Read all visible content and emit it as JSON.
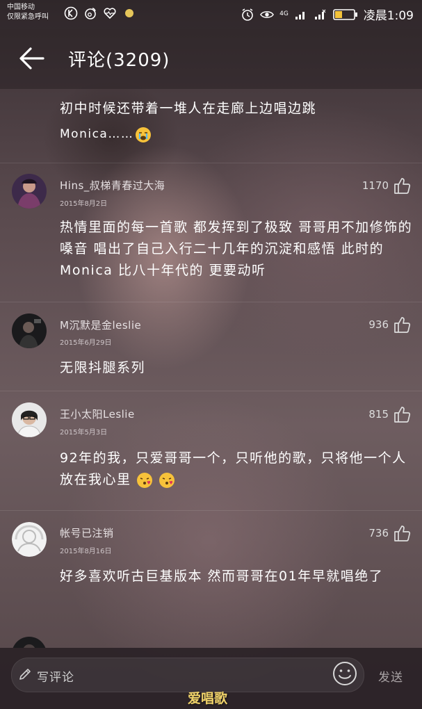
{
  "status_bar": {
    "carrier_line1": "中国移动",
    "carrier_line2": "仅限紧急呼叫",
    "network_label": "4G",
    "time": "凌晨1:09"
  },
  "header": {
    "title": "评论(3209)"
  },
  "top_comment": {
    "line1": "初中时候还带着一堆人在走廊上边唱边跳",
    "line2": "Monica……"
  },
  "comments": [
    {
      "user": "Hins_叔梯青春过大海",
      "date": "2015年8月2日",
      "likes": "1170",
      "text": "热情里面的每一首歌  都发挥到了极致  哥哥用不加修饰的嗓音  唱出了自己入行二十几年的沉淀和感悟  此时的Monica  比八十年代的  更要动听"
    },
    {
      "user": "M沉默是金leslie",
      "date": "2015年6月29日",
      "likes": "936",
      "text": "无限抖腿系列"
    },
    {
      "user": "王小太阳Leslie",
      "date": "2015年5月3日",
      "likes": "815",
      "text": "92年的我，只爱哥哥一个，只听他的歌，只将他一个人放在我心里"
    },
    {
      "user": "帐号已注销",
      "date": "2015年8月16日",
      "likes": "736",
      "text": "好多喜欢听古巨基版本  然而哥哥在01年早就唱绝了"
    }
  ],
  "footer": {
    "input_placeholder": "写评论",
    "send_label": "发送",
    "watermark": "爱唱歌"
  },
  "icons": {
    "back": "arrow-left-icon",
    "like": "thumbs-up-icon",
    "emoji": "smile-icon",
    "pencil": "pencil-icon"
  },
  "colors": {
    "watermark": "#f1d36a",
    "header_bg": "#2e2528"
  }
}
